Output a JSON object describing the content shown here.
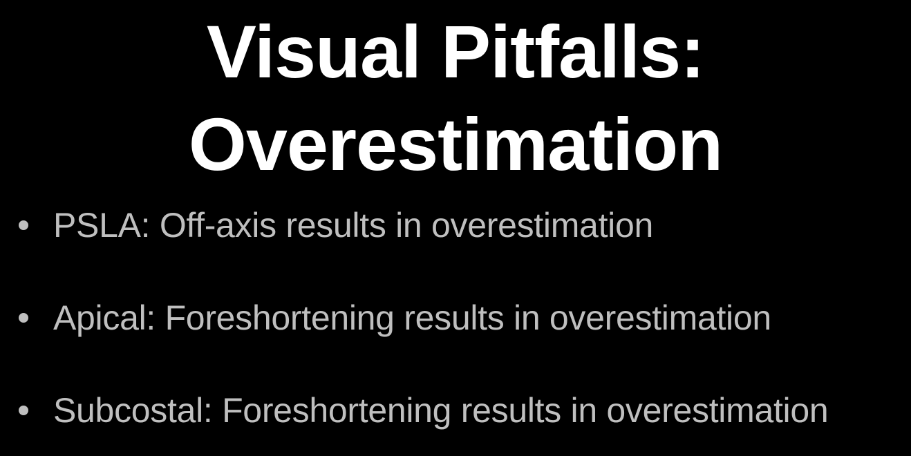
{
  "slide": {
    "title_line_1": "Visual Pitfalls:",
    "title_line_2": "Overestimation",
    "bullets": [
      {
        "text": "PSLA: Off-axis results in overestimation"
      },
      {
        "text": "Apical: Foreshortening results in overestimation"
      },
      {
        "text": "Subcostal: Foreshortening results in overestimation"
      }
    ],
    "colors": {
      "background": "#000000",
      "title": "#ffffff",
      "bullet_text": "#bfbfbf"
    }
  }
}
